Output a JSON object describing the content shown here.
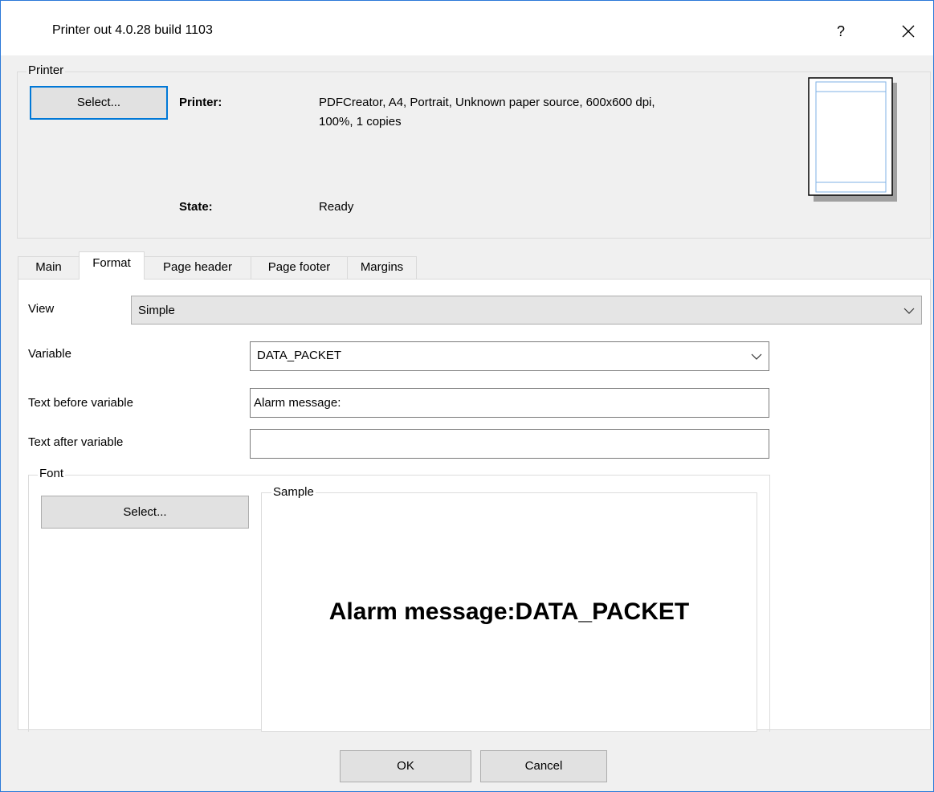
{
  "window": {
    "title": "Printer out 4.0.28 build 1103",
    "help_label": "?",
    "close_label": "×"
  },
  "printer_group": {
    "legend": "Printer",
    "select_label": "Select...",
    "printer_label": "Printer:",
    "printer_value_line1": "PDFCreator, A4, Portrait, Unknown paper source, 600x600 dpi,",
    "printer_value_line2": "100%, 1 copies",
    "state_label": "State:",
    "state_value": "Ready"
  },
  "tabs": [
    {
      "label": "Main"
    },
    {
      "label": "Format",
      "active": true
    },
    {
      "label": "Page header"
    },
    {
      "label": "Page footer"
    },
    {
      "label": "Margins"
    }
  ],
  "format": {
    "view_label": "View",
    "view_value": "Simple",
    "variable_label": "Variable",
    "variable_value": "DATA_PACKET",
    "text_before_label": "Text before variable",
    "text_before_value": "Alarm message:",
    "text_after_label": "Text after variable",
    "text_after_value": "",
    "font_legend": "Font",
    "font_select_label": "Select...",
    "sample_legend": "Sample",
    "sample_text": "Alarm message:DATA_PACKET"
  },
  "footer": {
    "ok_label": "OK",
    "cancel_label": "Cancel"
  },
  "icons": {
    "chevron": "chevron-down-icon",
    "page_preview": "page-preview-icon",
    "close": "close-icon",
    "help": "help-icon"
  }
}
